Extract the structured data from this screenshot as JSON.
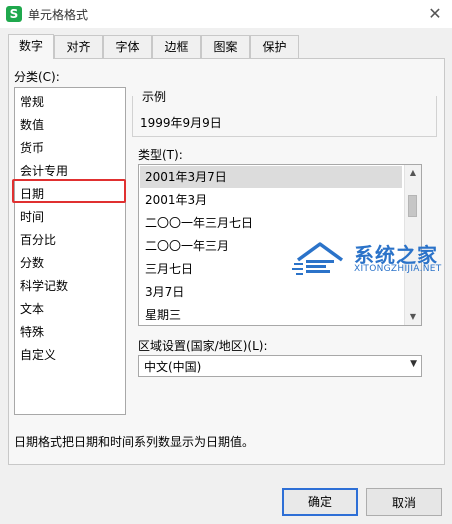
{
  "window": {
    "title": "单元格格式",
    "app_icon_letter": "S",
    "close_glyph": "✕"
  },
  "tabs": [
    {
      "label": "数字",
      "active": true
    },
    {
      "label": "对齐"
    },
    {
      "label": "字体"
    },
    {
      "label": "边框"
    },
    {
      "label": "图案"
    },
    {
      "label": "保护"
    }
  ],
  "category": {
    "label": "分类(C):",
    "items": [
      "常规",
      "数值",
      "货币",
      "会计专用",
      "日期",
      "时间",
      "百分比",
      "分数",
      "科学记数",
      "文本",
      "特殊",
      "自定义"
    ],
    "selected": "日期",
    "highlight_color": "#e03030"
  },
  "sample": {
    "caption": "示例",
    "value": "1999年9月9日"
  },
  "type": {
    "label": "类型(T):",
    "items": [
      "2001年3月7日",
      "2001年3月",
      "二〇〇一年三月七日",
      "二〇〇一年三月",
      "三月七日",
      "3月7日",
      "星期三"
    ],
    "selected": "2001年3月7日"
  },
  "locale": {
    "label": "区域设置(国家/地区)(L):",
    "value": "中文(中国)"
  },
  "description": "日期格式把日期和时间系列数显示为日期值。",
  "buttons": {
    "ok": "确定",
    "cancel": "取消"
  },
  "watermark": {
    "text": "系统之家",
    "sub": "XITONGZHIJIA.NET",
    "color": "#2b73c9"
  }
}
